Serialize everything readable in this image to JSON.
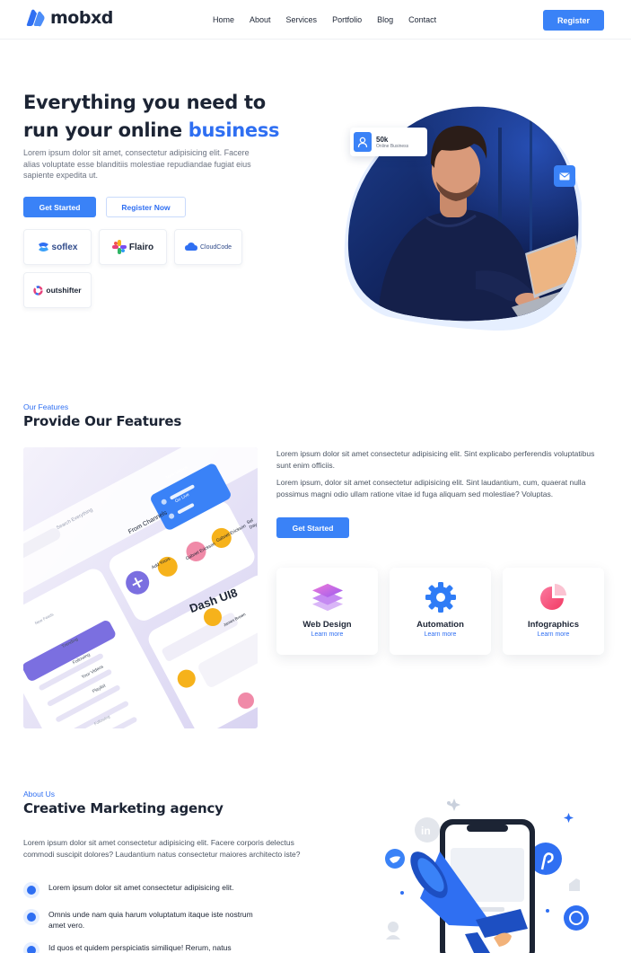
{
  "brand": {
    "name": "mobxd"
  },
  "nav": {
    "items": [
      "Home",
      "About",
      "Services",
      "Portfolio",
      "Blog",
      "Contact"
    ],
    "register_label": "Register"
  },
  "hero": {
    "title_line1": "Everything you need to",
    "title_line2_prefix": "run your online ",
    "title_accent": "business",
    "description": "Lorem ipsum dolor sit amet, consectetur adipisicing elit. Facere alias voluptate esse blanditiis molestiae repudiandae fugiat eius sapiente expedita ut.",
    "primary_cta": "Get Started",
    "secondary_cta": "Register Now",
    "partners": [
      {
        "name": "soflex",
        "icon": "soflex-logo"
      },
      {
        "name": "Flairo",
        "icon": "flairo-logo"
      },
      {
        "name": "CloudCode",
        "icon": "cloudcode-logo"
      },
      {
        "name": "outshifter",
        "icon": "outshifter-logo"
      }
    ],
    "stat": {
      "value": "50k",
      "label": "Online Business",
      "icon": "user-icon"
    },
    "badge_icon": "mail-icon"
  },
  "features": {
    "eyebrow": "Our Features",
    "title": "Provide Our Features",
    "para1": "Lorem ipsum dolor sit amet consectetur adipisicing elit. Sint explicabo perferendis voluptatibus sunt enim officiis.",
    "para2": "Lorem ipsum, dolor sit amet consectetur adipisicing elit. Sint laudantium, cum, quaerat nulla possimus magni odio ullam ratione vitae id fuga aliquam sed molestiae? Voluptas.",
    "cta": "Get Started",
    "cards": [
      {
        "title": "Web Design",
        "link": "Learn more",
        "icon": "layers-icon"
      },
      {
        "title": "Automation",
        "link": "Learn more",
        "icon": "gear-icon"
      },
      {
        "title": "Infographics",
        "link": "Learn more",
        "icon": "pie-chart-icon"
      }
    ],
    "mockup": {
      "dash_title": "Dash UI8",
      "search_placeholder": "Search Everything",
      "from_channels": "From Channels",
      "add_yours": "Add Yours",
      "people": [
        "Gabriel Erickson",
        "Gabriel Erickson",
        "Sel Day"
      ],
      "menu": [
        "New Feeds",
        "New Feed",
        "Trending",
        "Following",
        "Your Videos",
        "Playlist",
        "Following"
      ],
      "popup": [
        "New Videos",
        "Go Live"
      ],
      "commenter": "James Brown"
    },
    "colors": {
      "accent": "#3a82f7",
      "purple": "#8a7ee0"
    }
  },
  "about": {
    "eyebrow": "About Us",
    "title": "Creative Marketing agency",
    "description": "Lorem ipsum dolor sit amet consectetur adipisicing elit. Facere corporis delectus commodi suscipit dolores? Laudantium natus consectetur maiores architecto iste?",
    "items": [
      "Lorem ipsum dolor sit amet consectetur adipisicing elit.",
      "Omnis unde nam quia harum voluptatum itaque iste nostrum amet vero.",
      "Id quos et quidem perspiciatis similique! Rerum, natus"
    ]
  }
}
